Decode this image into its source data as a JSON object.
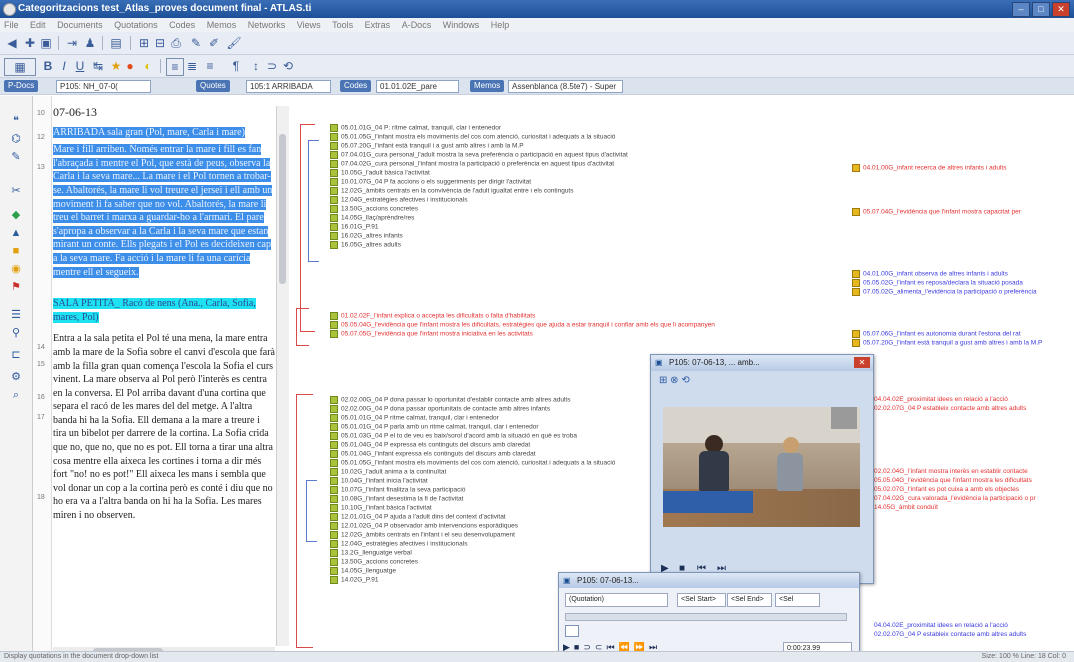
{
  "window": {
    "title": "Categoritzacions test_Atlas_proves document final - ATLAS.ti"
  },
  "menu": [
    "File",
    "Edit",
    "Documents",
    "Quotations",
    "Codes",
    "Memos",
    "Networks",
    "Views",
    "Tools",
    "Extras",
    "A-Docs",
    "Windows",
    "Help"
  ],
  "navigator": {
    "pdocs_label": "P-Docs",
    "pdocs_value": "P105: NH_07-0(",
    "quotes_label": "Quotes",
    "quotes_value": "105:1 ARRIBADA",
    "codes_label": "Codes",
    "codes_value": "01.01.02E_pare",
    "memos_label": "Memos",
    "memos_value": "Assenblanca (8.5te7) - Super"
  },
  "document": {
    "line_numbers": [
      "10",
      "12",
      "13",
      "14",
      "15",
      "16",
      "17",
      "18"
    ],
    "date": "07-06-13",
    "selected_heading": "ARRIBADA sala gran (Pol, mare, Carla i mare)",
    "selected_body": "Mare i fill arriben. Només entrar la mare i fill es fan l'abraçada i mentre el Pol, que està de peus, observa la Carla i la seva mare... La mare i el Pol tornen a trobar-se. Abaltorés, la mare li vol treure el jersei i ell amb un moviment li fa saber que no vol. Abaltorés, la mare li treu el barret i marxa a guardar-ho a l'armari. El pare s'apropa a observar a la Carla i la seva mare que estan mirant un conte. Ells plegats i el Pol es decideixen cap a la seva mare. Fa acció i la mare li fa una carícia mentre ell el segueix.",
    "cyan_heading": "SALA PETITA_ Racó de nens (Ana., Carla, Sofia, mares, Pol)",
    "body": "Entra a la sala petita el Pol té una mena, la mare entra amb la mare de la Sofia sobre el canvi d'escola que farà amb la filla gran quan comença l'escola la Sofia el curs vinent. La mare observa al Pol però l'interès es centra en la conversa. El Pol arriba davant d'una cortina que separa el racó de les mares del del metge. A l'altra banda hi ha la Sofia. Ell demana a la mare a treure i tira un bibelot per darrere de la cortina. La Sofia crida que no, que no, que no es pot. Ell torna a tirar una altra cosa mentre ella aixeca les cortines i torna a dir més fort \"no! no es pot!\" Ell aixeca les mans i sembla que vol donar un cop a la cortina però es conté i diu que no ho era va a l'altra banda on hi ha la Sofia. Les mares miren i no observen."
  },
  "codes_top": [
    {
      "text": "05.01.01G_04 P: rítme calmat, tranquil, clar i entenedor",
      "red": false
    },
    {
      "text": "05.01.05G_l'infant mostra els moviments del cos com atenció, curiositat i adequats a la situació",
      "red": false
    },
    {
      "text": "05.07.20G_l'infant està tranquil i a gust amb altres i amb la M.P",
      "red": false
    },
    {
      "text": "07.04.01G_cura personal_l'adult mostra la seva preferència o participació en aquest tipus d'activitat",
      "red": false
    },
    {
      "text": "07.04.02G_cura personal_l'infant mostra la participació o preferència en aquest tipus d'activitat",
      "red": false
    },
    {
      "text": "10.05G_l'adult bàsica l'activitat",
      "red": false
    },
    {
      "text": "10.01.07G_04 P fa accions o els suggeriments per dirigir l'activitat",
      "red": false
    },
    {
      "text": "12.02G_àmbits centrats en la convivència de l'adult igualtat entre i els continguts",
      "red": false
    },
    {
      "text": "12.04G_estratègies afectives i institucionals",
      "red": false
    },
    {
      "text": "13.50G_accions concretes",
      "red": false
    },
    {
      "text": "14.05G_llaç/aprèndre/res",
      "red": false
    },
    {
      "text": "16.01G_P.91",
      "red": false
    },
    {
      "text": "16.02G_altres infants",
      "red": false
    },
    {
      "text": "16.05G_altres adults",
      "red": false
    },
    {
      "text": "01.02.02F_l'infant explica o accepta les dificultats o falta d'habilitats",
      "red": true
    },
    {
      "text": "05.05.04G_l'evidència que l'infant mostra les dificultats, estratègies que ajuda a estar tranquil i confiar amb els que li acompanyen",
      "red": true
    },
    {
      "text": "05.07.05G_l'evidència que l'infant mostra iniciativa en les activitats",
      "red": true
    }
  ],
  "codes_bottom": [
    "02.02.00G_04 P dona passar lo oportunitat d'establir contacte amb altres adults",
    "02.02.00G_04 P dona passar oportunitats de contacte amb altres infants",
    "05.01.01G_04 P ritme calmat, tranquil, clar i entenedor",
    "05.01.01G_04 P parla amb un ritme calmat, tranquil, clar i entenedor",
    "05.01.03G_04 P el to de veu es baix/sorol d'acord amb la situació en què es troba",
    "05.01.04G_04 P expressa els continguts del discurs amb claredat",
    "05.01.04G_l'infant expressa els continguts del discurs amb claredat",
    "05.01.05G_l'infant mostra els moviments del cos com atenció, curiositat i adequats a la situació",
    "10.02G_l'adult anima a la continuïtat",
    "10.04G_l'infant inicia l'activitat",
    "10.07G_l'infant finalitza la seva participació",
    "10.08G_l'infant desestima la fi de l'activitat",
    "10.10G_l'infant bàsica l'activitat",
    "12.01.01G_04 P ajuda a l'adult dins del context d'activitat",
    "12.01.02G_04 P observador amb intervencions esporàdiques",
    "12.02G_àmbits centrats en l'infant i el seu desenvolupament",
    "12.04G_estratègies afectives i institucionals",
    "13.2G_llenguatge verbal",
    "13.50G_accions concretes",
    "14.05G_llenguatge",
    "14.02G_P.91"
  ],
  "codes_right": [
    {
      "text": "04.01.00G_infant recerca de altres infants i adults",
      "red": true
    },
    {
      "text": "05.07.04G_l'evidència que l'infant mostra capacitat per",
      "red": true
    },
    {
      "text": "04.01.00G_infant observa de altres infants i adults",
      "red": false
    },
    {
      "text": "05.05.02G_l'infant es reposa/declara la situació posada",
      "red": false
    },
    {
      "text": "07.05.02G_alimenta_l'evidència la participació o preferència",
      "red": false
    },
    {
      "text": "05.07.06G_l'infant es autonomia durant l'estona del rat",
      "red": false
    },
    {
      "text": "05.07.20G_l'infant està tranquil a gust amb altres i amb la M.P",
      "red": false
    }
  ],
  "codes_right_bottom": [
    {
      "text": "04.04.02E_proximitat idees en relació a l'acció",
      "red": true
    },
    {
      "text": "02.02.07G_04 P estableix contacte amb altres adults",
      "red": true
    },
    {
      "text": "02.02.04G_l'infant mostra interès en establir contacte",
      "red": true
    },
    {
      "text": "05.05.04G_l'evidència que l'infant mostra les dificultats",
      "red": true
    },
    {
      "text": "05.02.07G_l'infant es pot cuixa a amb els objectes",
      "red": true
    },
    {
      "text": "07.04.02G_cura valorada_l'evidència la participació o pr",
      "red": true
    },
    {
      "text": "14.05G_àmbit conduït",
      "red": true
    },
    {
      "text": "04.04.02E_proximitat idees en relació a l'acció",
      "red": false
    },
    {
      "text": "02.02.07G_04 P estableix contacte amb altres adults",
      "red": false
    }
  ],
  "video_window": {
    "title": "P105: 07-06-13, ... amb..."
  },
  "player2": {
    "title": "P105: 07-06-13...",
    "col1": "(Quotation)",
    "col2": "<Sel Start>",
    "col3": "<Sel End>",
    "col4": "<Sel",
    "time": "0:00:23.99"
  },
  "status": {
    "left": "Display quotations in the document drop-down list",
    "right": "Size: 100 %  Line: 18  Col: 0"
  }
}
